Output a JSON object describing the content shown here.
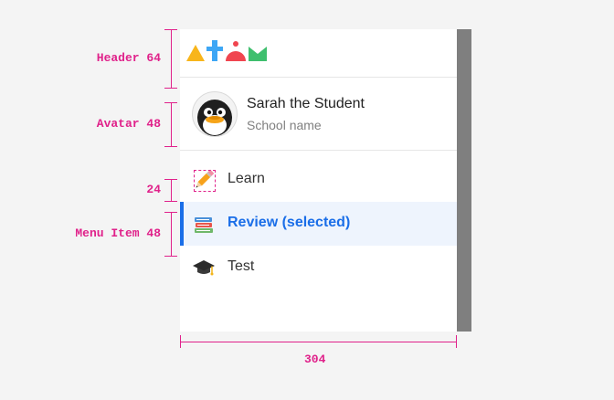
{
  "annotations": {
    "header": "Header 64",
    "avatar": "Avatar 48",
    "icon": "24",
    "menu_item": "Menu Item 48",
    "width": "304"
  },
  "profile": {
    "name": "Sarah the Student",
    "school": "School name"
  },
  "menu": {
    "items": [
      {
        "label": "Learn",
        "icon": "pencil-icon",
        "selected": false
      },
      {
        "label": "Review (selected)",
        "icon": "books-icon",
        "selected": true
      },
      {
        "label": "Test",
        "icon": "graduation-cap-icon",
        "selected": false
      }
    ]
  },
  "colors": {
    "annotation": "#e0218a",
    "selected_accent": "#1a6ee8",
    "selected_background": "#eef4fd",
    "scrollbar": "#7f7f7f",
    "logo_yellow": "#f8b51b",
    "logo_blue": "#3da6f5",
    "logo_red": "#f0454f",
    "logo_green": "#3fbf6e"
  }
}
